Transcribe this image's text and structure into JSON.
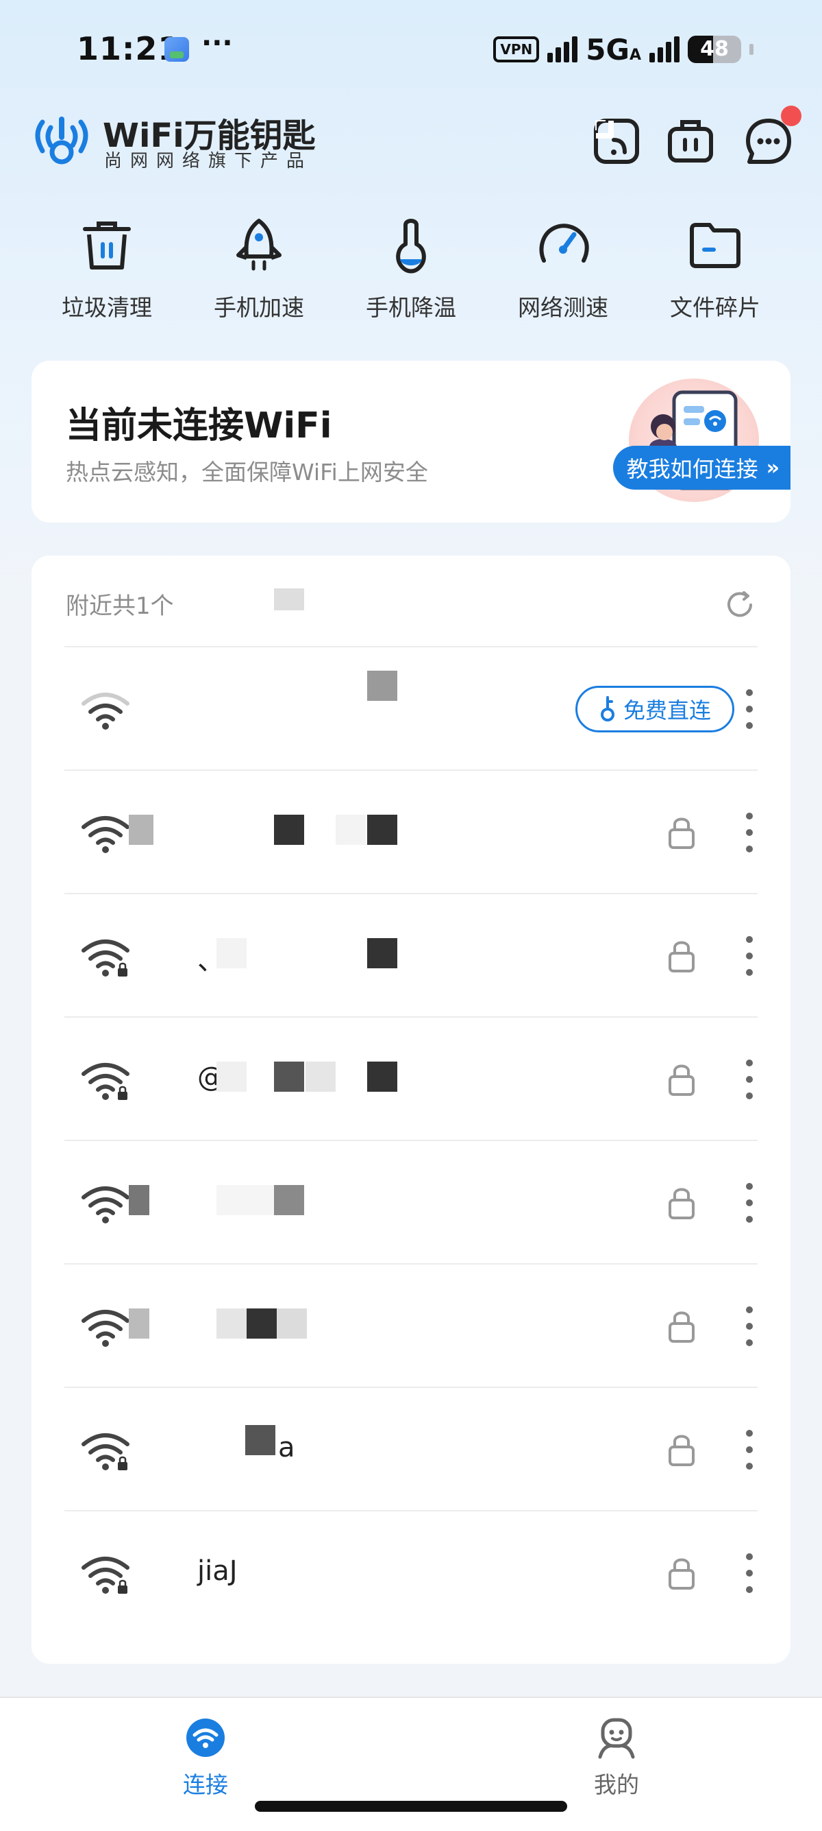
{
  "status_bar": {
    "time": "11:21",
    "more": "···",
    "vpn": "VPN",
    "network": "5G",
    "network_sub": "A",
    "battery": "48",
    "battery_level": 0.48
  },
  "header": {
    "title": "WiFi万能钥匙",
    "subtitle": "尚网网络旗下产品"
  },
  "tools": [
    {
      "label": "垃圾清理",
      "icon": "trash-icon"
    },
    {
      "label": "手机加速",
      "icon": "rocket-icon"
    },
    {
      "label": "手机降温",
      "icon": "thermometer-icon"
    },
    {
      "label": "网络测速",
      "icon": "speedometer-icon"
    },
    {
      "label": "文件碎片",
      "icon": "folder-icon"
    }
  ],
  "status_card": {
    "title": "当前未连接WiFi",
    "subtitle": "热点云感知，全面保障WiFi上网安全",
    "guide_button": "教我如何连接",
    "guide_chevron": "»"
  },
  "wifi_list": {
    "header": "附近共1个",
    "free_connect_label": "免费直连",
    "networks": [
      {
        "ssid": "",
        "secured": false,
        "free": true
      },
      {
        "ssid": "",
        "secured": true
      },
      {
        "ssid": "、",
        "secured": true
      },
      {
        "ssid": "@",
        "secured": true
      },
      {
        "ssid": "",
        "secured": true
      },
      {
        "ssid": "",
        "secured": true
      },
      {
        "ssid": "a",
        "secured": true
      },
      {
        "ssid": "jiaJ",
        "secured": true
      }
    ]
  },
  "bottom_nav": {
    "items": [
      {
        "label": "连接",
        "active": true
      },
      {
        "label": "我的",
        "active": false
      }
    ]
  },
  "colors": {
    "accent": "#1a7ee0",
    "badge": "#f25050"
  }
}
